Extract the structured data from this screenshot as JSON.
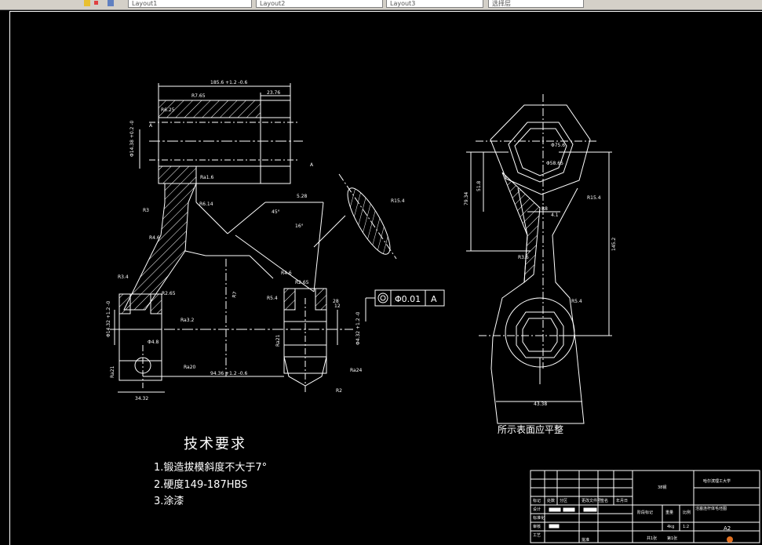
{
  "toolbar": {
    "tabs": [
      "Layout1",
      "Layout2",
      "Layout3",
      "选择层"
    ]
  },
  "drawing": {
    "left_view": {
      "dims": [
        "185.6 +1.2 -0.6",
        "R7.65",
        "23.76",
        "R6.25",
        "Φ14.38 +0.2 -0",
        "Ra1.6",
        "R6.14",
        "R3",
        "R4.6",
        "Φ14.32 +1.2 -0",
        "Ra3.2",
        "R3.4",
        "R2.65",
        "Ra21",
        "Ra20",
        "Φ4.8",
        "34.32",
        "94.36 +1.2 -0.6",
        "R7",
        "5.28",
        "45°",
        "16°",
        "R4.6",
        "R5.4",
        "Ra24",
        "R2.65",
        "Φ4.32 +1.2 -0",
        "Ra21",
        "R2",
        "12",
        "R15.4",
        "A",
        "A",
        "28"
      ],
      "tolerance_box": [
        "◎",
        "Φ0.01",
        "A"
      ]
    },
    "right_view": {
      "dims": [
        "Φ75.6",
        "Φ58.65",
        "51.8",
        "79.34",
        "145.2",
        "4.1",
        "R8",
        "R3.6",
        "R5.4",
        "R15.4",
        "43.38"
      ],
      "note": "所示表面应平整"
    }
  },
  "requirements": {
    "title": "技术要求",
    "items": [
      "1.锻造拔模斜度不大于7°",
      "2.硬度149-187HBS",
      "3.涂漆"
    ]
  },
  "title_block": {
    "material": "38钢",
    "school": "哈尔滨理工大学",
    "part_name": "活塞连杆体毛坯图",
    "row_labels": [
      "标记",
      "处数",
      "分区",
      "更改文件号",
      "签名",
      "年月日",
      "设计",
      "标准化",
      "审核",
      "工艺",
      "批准"
    ],
    "stage_labels": [
      "阶段标记",
      "重量",
      "比例"
    ],
    "weight": "4kg",
    "scale": "1:2",
    "sheet": "A2",
    "footer": [
      "共1张",
      "第1张"
    ]
  }
}
